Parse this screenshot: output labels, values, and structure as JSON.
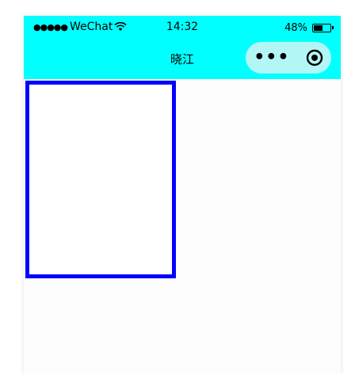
{
  "colors": {
    "header_bg": "#00ffff",
    "capsule_bg": "#b3f6f6",
    "box_border": "#0000ff"
  },
  "status_bar": {
    "signal": "●●●●●",
    "carrier": "WeChat",
    "time": "14:32",
    "battery_percent": "48%",
    "battery_level": 0.48,
    "wifi_icon": "wifi-icon"
  },
  "nav": {
    "title": "晓江",
    "more_icon": "•••",
    "target_icon": "target-icon"
  },
  "content": {
    "box": {
      "border_color": "#0000ff"
    }
  }
}
